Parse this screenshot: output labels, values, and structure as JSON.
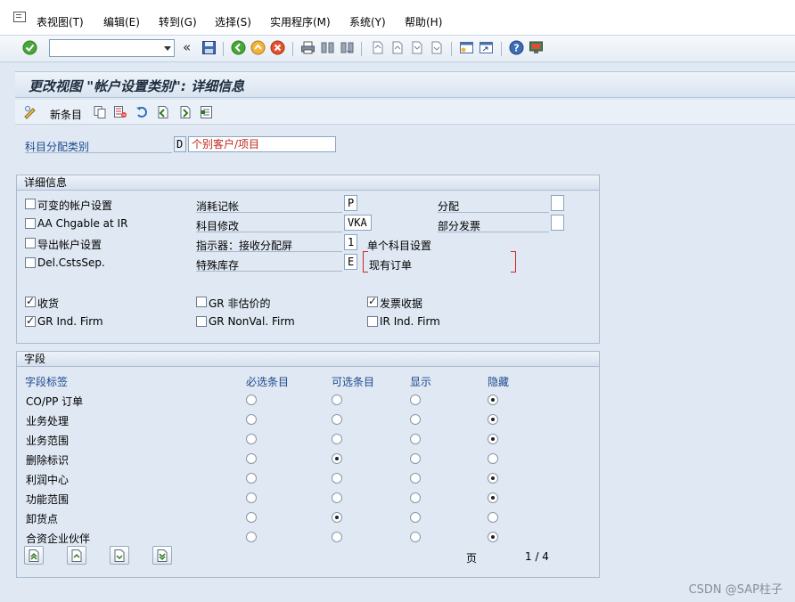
{
  "menu": {
    "items": [
      "表视图(T)",
      "编辑(E)",
      "转到(G)",
      "选择(S)",
      "实用程序(M)",
      "系统(Y)",
      "帮助(H)"
    ]
  },
  "toolbar": {
    "command_value": "",
    "back_glyph": "«"
  },
  "title": "更改视图 \"帐户设置类别\": 详细信息",
  "app_toolbar": {
    "new_entry": "新条目"
  },
  "header_field": {
    "label": "科目分配类别",
    "code": "D",
    "description": "个别客户/项目"
  },
  "detail_group": {
    "title": "详细信息",
    "checkboxes": [
      {
        "label": "可变的帐户设置",
        "checked": false
      },
      {
        "label": "AA Chgable at IR",
        "checked": false
      },
      {
        "label": "导出帐户设置",
        "checked": false
      },
      {
        "label": "Del.CstsSep.",
        "checked": false
      }
    ],
    "fields": [
      {
        "label": "消耗记帐",
        "value": "P"
      },
      {
        "label": "科目修改",
        "value": "VKA"
      },
      {
        "label": "指示器：接收分配屏",
        "value": "1",
        "desc": "单个科目设置"
      },
      {
        "label": "特殊库存",
        "value": "E",
        "desc": "现有订单"
      }
    ],
    "right_fields": [
      {
        "label": "分配",
        "value": ""
      },
      {
        "label": "部分发票",
        "value": ""
      }
    ],
    "flags": [
      {
        "label": "收货",
        "checked": true
      },
      {
        "label": "GR 非估价的",
        "checked": false
      },
      {
        "label": "发票收据",
        "checked": true
      },
      {
        "label": "GR Ind. Firm",
        "checked": true
      },
      {
        "label": "GR NonVal. Firm",
        "checked": false
      },
      {
        "label": "IR Ind. Firm",
        "checked": false
      }
    ]
  },
  "fields_group": {
    "title": "字段",
    "columns": [
      "字段标签",
      "必选条目",
      "可选条目",
      "显示",
      "隐藏"
    ],
    "rows": [
      {
        "label": "CO/PP 订单",
        "selected": "隐藏"
      },
      {
        "label": "业务处理",
        "selected": "隐藏"
      },
      {
        "label": "业务范围",
        "selected": "隐藏"
      },
      {
        "label": "删除标识",
        "selected": "可选条目"
      },
      {
        "label": "利润中心",
        "selected": "隐藏"
      },
      {
        "label": "功能范围",
        "selected": "隐藏"
      },
      {
        "label": "卸货点",
        "selected": "可选条目"
      },
      {
        "label": "合资企业伙伴",
        "selected": "隐藏"
      }
    ],
    "page_label": "页",
    "page_value": "1 / 4"
  },
  "watermark": "CSDN @SAP柱子",
  "colors": {
    "background": "#dfe8f3",
    "label_blue": "#1d4a8c",
    "required_red": "#d2271f"
  }
}
